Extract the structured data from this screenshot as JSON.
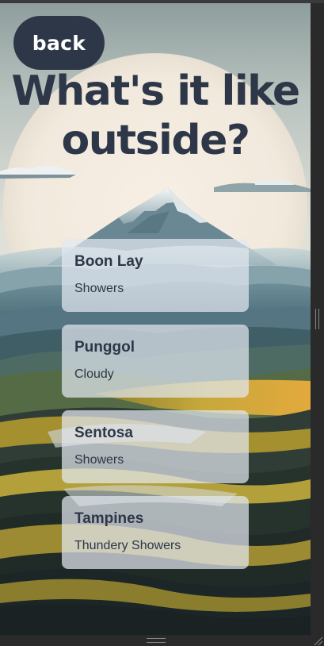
{
  "header": {
    "back_label": "back",
    "title": "What's it like outside?"
  },
  "forecasts": [
    {
      "city": "Boon Lay",
      "forecast": "Showers"
    },
    {
      "city": "Punggol",
      "forecast": "Cloudy"
    },
    {
      "city": "Sentosa",
      "forecast": "Showers"
    },
    {
      "city": "Tampines",
      "forecast": "Thundery Showers"
    }
  ],
  "colors": {
    "accent_dark": "#2d3748",
    "card_bg": "#e2e8f0",
    "sun": "#f3ece2",
    "mountain": "#5e7f8c",
    "hills_gold": "#b9a23a"
  },
  "icons": {
    "background": "mountain-landscape-illustration",
    "resize_handle": "grip-icon"
  }
}
